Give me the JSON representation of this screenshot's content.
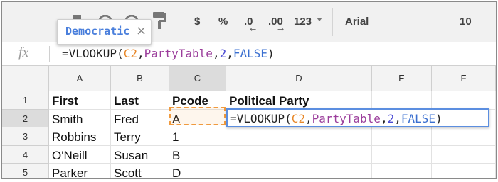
{
  "toolbar": {
    "currency": "$",
    "percent": "%",
    "decrease_decimals": ".0",
    "increase_decimals": ".00",
    "number_format": "123",
    "font": "Arial",
    "font_size": "10"
  },
  "autocomplete": {
    "label": "Democratic",
    "close": "×"
  },
  "formula_bar": {
    "fx": "fx",
    "parts": {
      "p1": "=VLOOKUP(",
      "p2": "C2",
      "p3": ",",
      "p4": "PartyTable",
      "p5": ",",
      "p6": "2",
      "p7": ",",
      "p8": "FALSE",
      "p9": ")"
    }
  },
  "colors": {
    "cell_ref": "#e8892b",
    "range_name": "#9b3d9b",
    "number": "#4a4ad4",
    "boolean": "#3a6fd0",
    "edit_border": "#5b8ee0"
  },
  "sheet": {
    "columns": [
      "A",
      "B",
      "C",
      "D",
      "E",
      "F"
    ],
    "selected_column": "C",
    "rows": [
      "1",
      "2",
      "3",
      "4",
      "5"
    ],
    "selected_row": "2",
    "cells": {
      "A1": "First",
      "B1": "Last",
      "C1": "Pcode",
      "D1": "Political Party",
      "A2": "Smith",
      "B2": "Fred",
      "C2": "A",
      "A3": "Robbins",
      "B3": "Terry",
      "C3": "1",
      "A4": "O'Neill",
      "B4": "Susan",
      "C4": "B",
      "A5": "Parker",
      "B5": "Scott",
      "C5": "D"
    }
  },
  "editor": {
    "parts": {
      "p1": "=VLOOKUP(",
      "p2": "C2",
      "p3": ",",
      "p4": "PartyTable",
      "p5": ",",
      "p6": "2",
      "p7": ",",
      "p8": "FALSE",
      "p9": ")"
    }
  }
}
